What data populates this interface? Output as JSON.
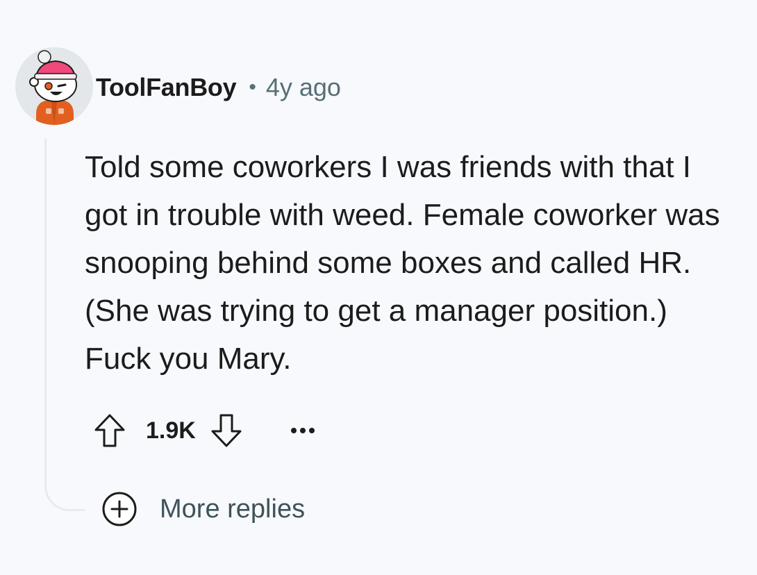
{
  "comment": {
    "author": "ToolFanBoy",
    "separator": "•",
    "time_ago": "4y ago",
    "body": "Told some coworkers I was friends with that I got in trouble with weed. Female coworker was snooping behind some boxes and called HR. (She was trying to get a manager position.) Fuck you Mary.",
    "score": "1.9K",
    "more_replies_label": "More replies"
  },
  "icons": {
    "avatar": "snoo-avatar-icon",
    "upvote": "upvote-arrow-icon",
    "downvote": "downvote-arrow-icon",
    "overflow": "ellipsis-icon",
    "expand": "plus-circle-icon"
  },
  "colors": {
    "background": "#f7f9fc",
    "text": "#1c1c1c",
    "meta": "#576f76",
    "thread_line": "#e5ebee",
    "avatar_accent": "#f04a7a",
    "avatar_body": "#e2601f"
  }
}
